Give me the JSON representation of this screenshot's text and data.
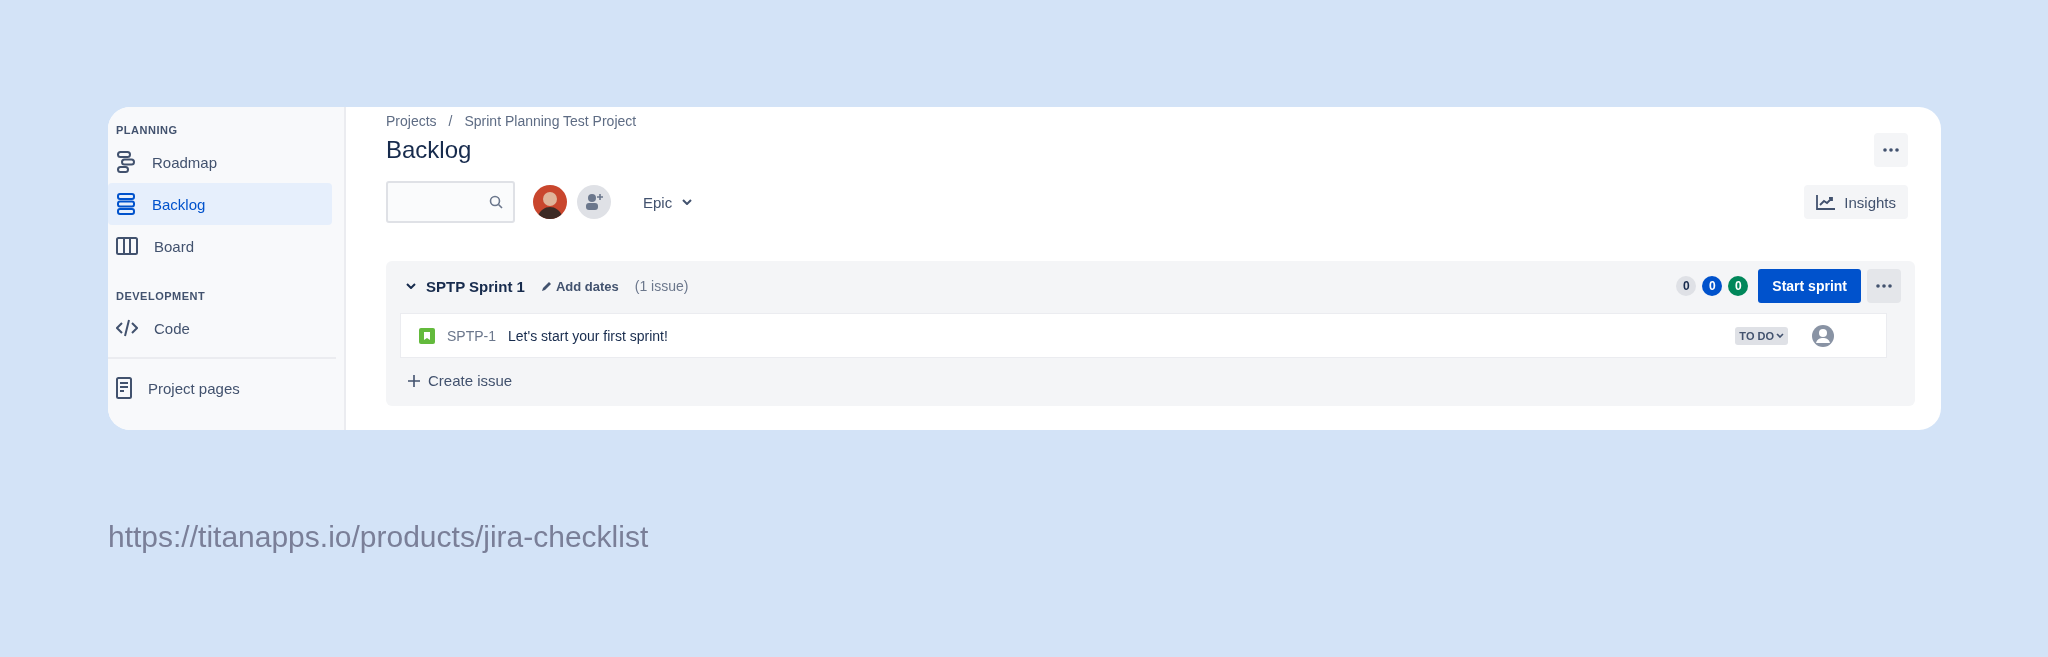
{
  "sidebar": {
    "sections": [
      {
        "heading": "PLANNING",
        "items": [
          {
            "label": "Roadmap",
            "kind": "roadmap",
            "selected": false
          },
          {
            "label": "Backlog",
            "kind": "backlog",
            "selected": true
          },
          {
            "label": "Board",
            "kind": "board",
            "selected": false
          }
        ]
      },
      {
        "heading": "DEVELOPMENT",
        "items": [
          {
            "label": "Code",
            "kind": "code",
            "selected": false
          }
        ]
      }
    ],
    "footer_item": {
      "label": "Project pages"
    }
  },
  "breadcrumbs": [
    "Projects",
    "Sprint Planning Test Project"
  ],
  "breadcrumb_separator": "/",
  "title": "Backlog",
  "toolbar": {
    "epic_filter": "Epic",
    "insights": "Insights"
  },
  "sprint": {
    "name": "SPTP Sprint 1",
    "add_dates": "Add dates",
    "issue_count": "(1 issue)",
    "expanded": true,
    "counts": [
      {
        "value": "0",
        "color": "#dfe1e6"
      },
      {
        "value": "0",
        "color": "#0052cc"
      },
      {
        "value": "0",
        "color": "#00875a"
      }
    ],
    "start_button": "Start sprint",
    "issues": [
      {
        "key": "SPTP-1",
        "summary": "Let's start your first sprint!",
        "status": "TO DO"
      }
    ],
    "create_issue": "Create issue"
  },
  "source_caption": "https://titanapps.io/products/jira-checklist"
}
